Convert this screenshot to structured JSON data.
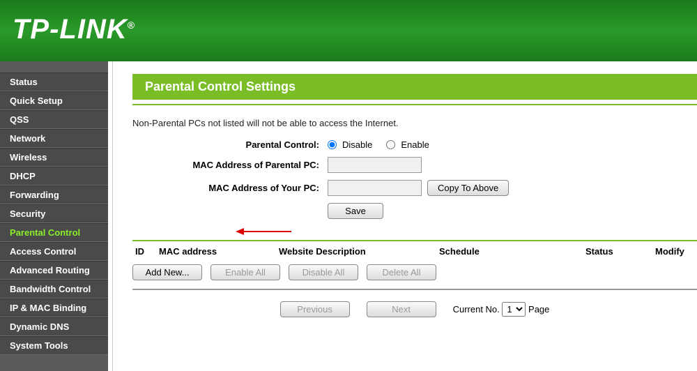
{
  "brand": "TP-LINK",
  "sidebar": {
    "items": [
      {
        "label": "Status"
      },
      {
        "label": "Quick Setup"
      },
      {
        "label": "QSS"
      },
      {
        "label": "Network"
      },
      {
        "label": "Wireless"
      },
      {
        "label": "DHCP"
      },
      {
        "label": "Forwarding"
      },
      {
        "label": "Security"
      },
      {
        "label": "Parental Control",
        "active": true
      },
      {
        "label": "Access Control"
      },
      {
        "label": "Advanced Routing"
      },
      {
        "label": "Bandwidth Control"
      },
      {
        "label": "IP & MAC Binding"
      },
      {
        "label": "Dynamic DNS"
      },
      {
        "label": "System Tools"
      }
    ]
  },
  "main": {
    "title": "Parental Control Settings",
    "infoText": "Non-Parental PCs not listed will not be able to access the Internet.",
    "form": {
      "parentalControlLabel": "Parental Control:",
      "disableLabel": "Disable",
      "enableLabel": "Enable",
      "macParentalLabel": "MAC Address of Parental PC:",
      "macParentalValue": "",
      "macYourLabel": "MAC Address of Your PC:",
      "macYourValue": "",
      "copyBtn": "Copy To Above",
      "saveBtn": "Save"
    },
    "table": {
      "headers": {
        "id": "ID",
        "mac": "MAC address",
        "desc": "Website Description",
        "schedule": "Schedule",
        "status": "Status",
        "modify": "Modify"
      },
      "actions": {
        "addNew": "Add New...",
        "enableAll": "Enable All",
        "disableAll": "Disable All",
        "deleteAll": "Delete All"
      }
    },
    "pager": {
      "prev": "Previous",
      "next": "Next",
      "currentLabel": "Current No.",
      "currentValue": "1",
      "pageLabel": "Page"
    }
  }
}
